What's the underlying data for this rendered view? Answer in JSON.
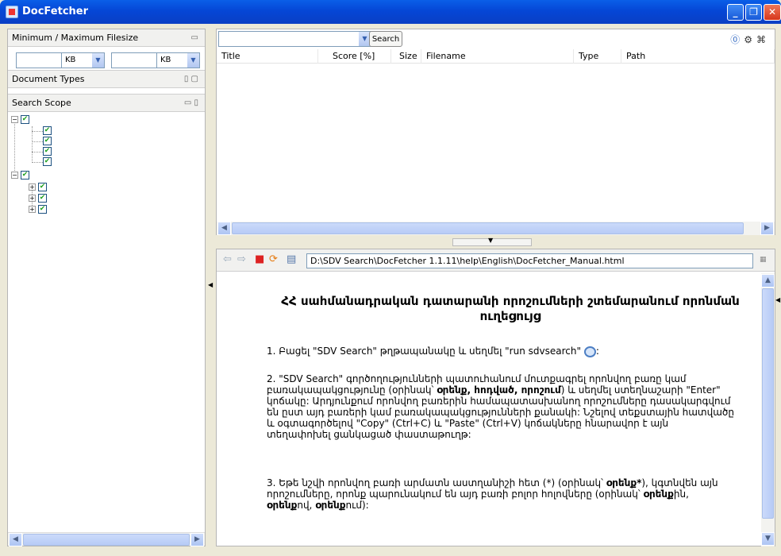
{
  "window": {
    "title": "DocFetcher"
  },
  "filesize": {
    "header": "Minimum / Maximum Filesize",
    "min_unit": "KB",
    "max_unit": "KB"
  },
  "doctypes": {
    "header": "Document Types"
  },
  "scope": {
    "header": "Search Scope"
  },
  "search": {
    "button_label": "Search"
  },
  "results": {
    "columns": [
      "Title",
      "Score [%]",
      "Size",
      "Filename",
      "Type",
      "Path"
    ]
  },
  "preview": {
    "address": "D:\\SDV Search\\DocFetcher 1.1.11\\help\\English\\DocFetcher_Manual.html",
    "heading": "ՀՀ սահմանադրական դատարանի որոշումների շտեմարանում որոնման ուղեցույց",
    "p1": "1. Բացել \"SDV Search\" թղթապանակը և սեղմել \"run sdvsearch\"",
    "p1_end": ":",
    "p2_a": "2. \"SDV Search\" գործողությունների պատուհանում մուտքագրել որոնվող բառը կամ բառակապակցությունը (օրինակ՝ ",
    "p2_b1": "օրենք",
    "p2_sep1": ", ",
    "p2_b2": "հոդված",
    "p2_sep2": ", ",
    "p2_b3": "որոշում",
    "p2_c": ") և սեղմել ստեղնաշարի \"Enter\" կոճակը: Արդյունքում որոնվող բառերին համապատասխանող որոշումները դասակարգվում են ըստ այդ բառերի կամ բառակապակցությունների քանակի: Նշելով տեքստային հատվածը և օգտագործելով \"Copy\" (Ctrl+C) և \"Paste\" (Ctrl+V) կոճակները հնարավոր է այն տեղափոխել ցանկացած փաստաթուղթ:",
    "p3_a": "3. Եթե նշվի որոնվող բառի արմատն աստղանիշի հետ (*) (օրինակ՝ ",
    "p3_b1": "օրենք*",
    "p3_c": "), կգտնվեն այն որոշումները, որոնք պարունակում են այդ բառի բոլոր հոլովները (օրինակ՝ ",
    "p3_b2": "օրենք",
    "p3_d": "ին, ",
    "p3_b3": "օրենք",
    "p3_e": "ով, ",
    "p3_b4": "օրենք",
    "p3_f": "ում):"
  }
}
